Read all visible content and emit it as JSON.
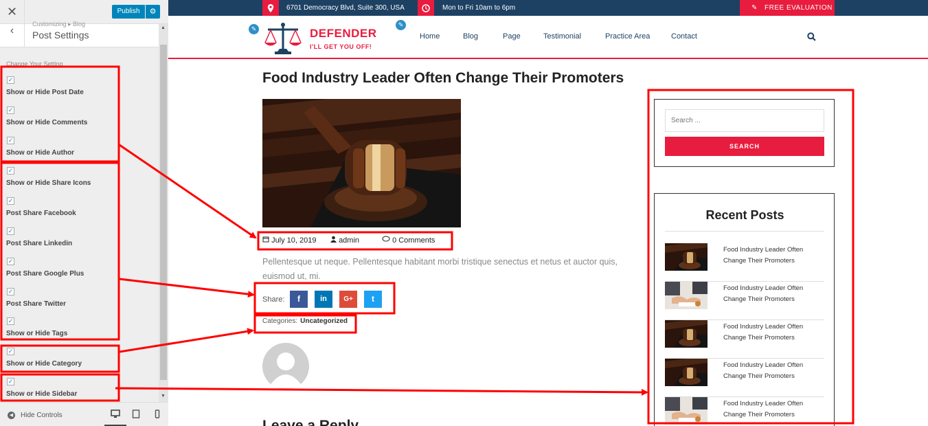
{
  "sidebar": {
    "close_icon": "close-icon",
    "publish_label": "Publish",
    "settings_icon": "gear-icon",
    "breadcrumb": "Customizing ▸ Blog",
    "section_title": "Post Settings",
    "change_label": "Change Your Setting",
    "options": [
      {
        "label": "Show or Hide Post Date",
        "checked": true
      },
      {
        "label": "Show or Hide Comments",
        "checked": true
      },
      {
        "label": "Show or Hide Author",
        "checked": true
      },
      {
        "label": "Show or Hide Share Icons",
        "checked": true
      },
      {
        "label": "Post Share Facebook",
        "checked": true
      },
      {
        "label": "Post Share Linkedin",
        "checked": true
      },
      {
        "label": "Post Share Google Plus",
        "checked": true
      },
      {
        "label": "Post Share Twitter",
        "checked": true
      },
      {
        "label": "Show or Hide Tags",
        "checked": true
      },
      {
        "label": "Show or Hide Category",
        "checked": true
      },
      {
        "label": "Show or Hide Sidebar",
        "checked": true
      }
    ],
    "hide_controls_label": "Hide Controls"
  },
  "topbar": {
    "address": "6701 Democracy Blvd, Suite 300, USA",
    "hours": "Mon to Fri 10am to 6pm",
    "evaluation": "FREE EVALUATION"
  },
  "brand": {
    "name": "DEFENDER",
    "tagline": "I'LL GET YOU OFF!"
  },
  "nav": [
    "Home",
    "Blog",
    "Page",
    "Testimonial",
    "Practice Area",
    "Contact"
  ],
  "post": {
    "title": "Food Industry Leader Often Change Their Promoters",
    "date": "July 10, 2019",
    "author": "admin",
    "comments": "0 Comments",
    "excerpt": "Pellentesque ut neque. Pellentesque habitant morbi tristique senectus et netus et auctor quis, euismod ut, mi.",
    "share_label": "Share:",
    "share_buttons": [
      "f",
      "in",
      "G+",
      "t"
    ],
    "categories_label": "Categories:",
    "category": "Uncategorized",
    "reply_title": "Leave a Reply"
  },
  "search": {
    "placeholder": "Search ...",
    "button": "SEARCH"
  },
  "recent": {
    "title": "Recent Posts",
    "items": [
      {
        "title": "Food Industry Leader Often Change Their Promoters",
        "thumb": "gavel"
      },
      {
        "title": "Food Industry Leader Often Change Their Promoters",
        "thumb": "hands"
      },
      {
        "title": "Food Industry Leader Often Change Their Promoters",
        "thumb": "gavel"
      },
      {
        "title": "Food Industry Leader Often Change Their Promoters",
        "thumb": "gavel"
      },
      {
        "title": "Food Industry Leader Often Change Their Promoters",
        "thumb": "hands"
      }
    ]
  },
  "colors": {
    "accent": "#e81c3e",
    "navy": "#1d4163",
    "wp_blue": "#0085ba",
    "facebook": "#3b5998",
    "linkedin": "#0077b5",
    "google": "#dd4b39",
    "twitter": "#1da1f2",
    "annotation": "#ff0000"
  }
}
